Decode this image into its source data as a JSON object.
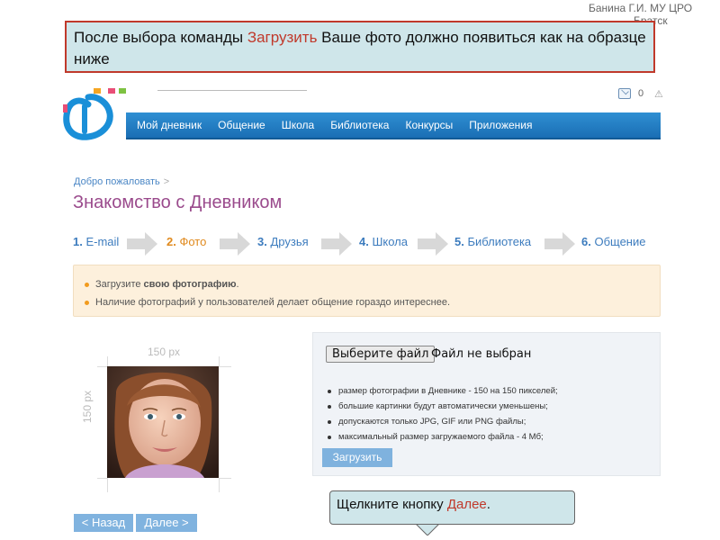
{
  "author": {
    "line1": "Банина Г.И. МУ ЦРО",
    "line2": "Братск"
  },
  "callout_top": {
    "before": "После выбора команды ",
    "highlight": "Загрузить",
    "after": " Ваше фото должно появиться как на образце ниже"
  },
  "header": {
    "mail_count": "0",
    "warn": "⚠"
  },
  "nav": [
    "Мой дневник",
    "Общение",
    "Школа",
    "Библиотека",
    "Конкурсы",
    "Приложения"
  ],
  "breadcrumb": {
    "label": "Добро пожаловать",
    "sep": ">"
  },
  "page_title": "Знакомство с Дневником",
  "steps": [
    {
      "num": "1.",
      "label": "E-mail"
    },
    {
      "num": "2.",
      "label": "Фото"
    },
    {
      "num": "3.",
      "label": "Друзья"
    },
    {
      "num": "4.",
      "label": "Школа"
    },
    {
      "num": "5.",
      "label": "Библиотека"
    },
    {
      "num": "6.",
      "label": "Общение"
    }
  ],
  "active_step": 2,
  "info": {
    "row1_before": "Загрузите ",
    "row1_bold": "свою фотографию",
    "row1_after": ".",
    "row2": "Наличие фотографий у пользователей делает общение гораздо интереснее."
  },
  "photo": {
    "width_label": "150 px",
    "height_label": "150 px"
  },
  "upload": {
    "choose_label": "Выберите файл",
    "status": "Файл не выбран",
    "requirements": [
      "размер фотографии в Дневнике - 150 на 150 пикселей;",
      "большие картинки будут автоматически уменьшены;",
      "допускаются только JPG, GIF или PNG файлы;",
      "максимальный размер загружаемого файла - 4 Мб;"
    ],
    "upload_label": "Загрузить"
  },
  "callout_bottom": {
    "before": "Щелкните кнопку ",
    "highlight": "Далее",
    "after": "."
  },
  "buttons": {
    "back": "< Назад",
    "next": "Далее >"
  },
  "colors": {
    "accent_red": "#c0392b",
    "nav_blue": "#1a6eb4",
    "step_active": "#e08a1e",
    "title_purple": "#9a4a8c"
  }
}
